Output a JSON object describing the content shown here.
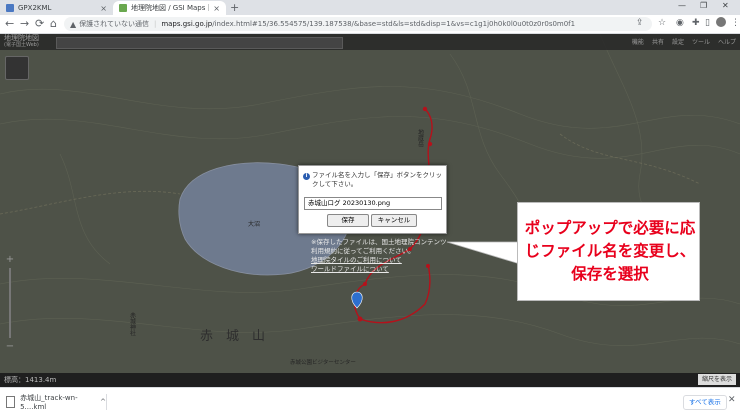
{
  "tabs": [
    {
      "title": "GPX2KML",
      "close": "×"
    },
    {
      "title": "地理院地図 / GSI Maps｜国土地理院",
      "close": "×"
    }
  ],
  "new_tab": "+",
  "window_controls": {
    "minimize": "—",
    "restore": "❐",
    "close": "✕"
  },
  "toolbar": {
    "back": "←",
    "forward": "→",
    "reload": "⟳",
    "home": "⌂",
    "security_icon": "▲",
    "security_text": "保護されていない通信",
    "url_host": "maps.gsi.go.jp",
    "url_path": "/index.html#15/36.554575/139.187538/&base=std&ls=std&disp=1&vs=c1g1j0h0k0l0u0t0z0r0s0m0f1",
    "icons": [
      "share-icon",
      "star-icon",
      "extension-icon",
      "puzzle-icon",
      "sidepanel-icon",
      "avatar",
      "menu-icon"
    ]
  },
  "map": {
    "gsi_logo": "地理院地図",
    "gsi_logo_sub": "(電子国土Web)",
    "menu_items": [
      "機能",
      "共有",
      "設定",
      "ツール",
      "ヘルプ"
    ],
    "zoom_in": "+",
    "zoom_out": "−",
    "place_labels": {
      "mountain": "赤　城　山",
      "lake": "大沼",
      "hill": "地蔵岳",
      "shrine": "赤城神社",
      "visitor": "赤城公園ビジターセンター"
    }
  },
  "dialog": {
    "info_icon": "i",
    "message": "ファイル名を入力し「保存」ボタンをクリックして下さい。",
    "filename": "赤城山ログ 20230130.png",
    "save_label": "保存",
    "cancel_label": "キャンセル"
  },
  "notes": {
    "line1": "※保存したファイルは、国土地理院コンテンツ利用規約に従ってご利用ください。",
    "link1": "地理院タイルのご利用について",
    "link2": "ワールドファイルについて"
  },
  "callout": {
    "text": "ポップアップで必要に応じファイル名を変更し、保存を選択"
  },
  "status": {
    "elevation": "標高：1413.4m",
    "scale": "縮尺を表示"
  },
  "download": {
    "filename": "赤城山_track-wn-5....kml",
    "show_all": "すべて表示",
    "close": "✕"
  }
}
